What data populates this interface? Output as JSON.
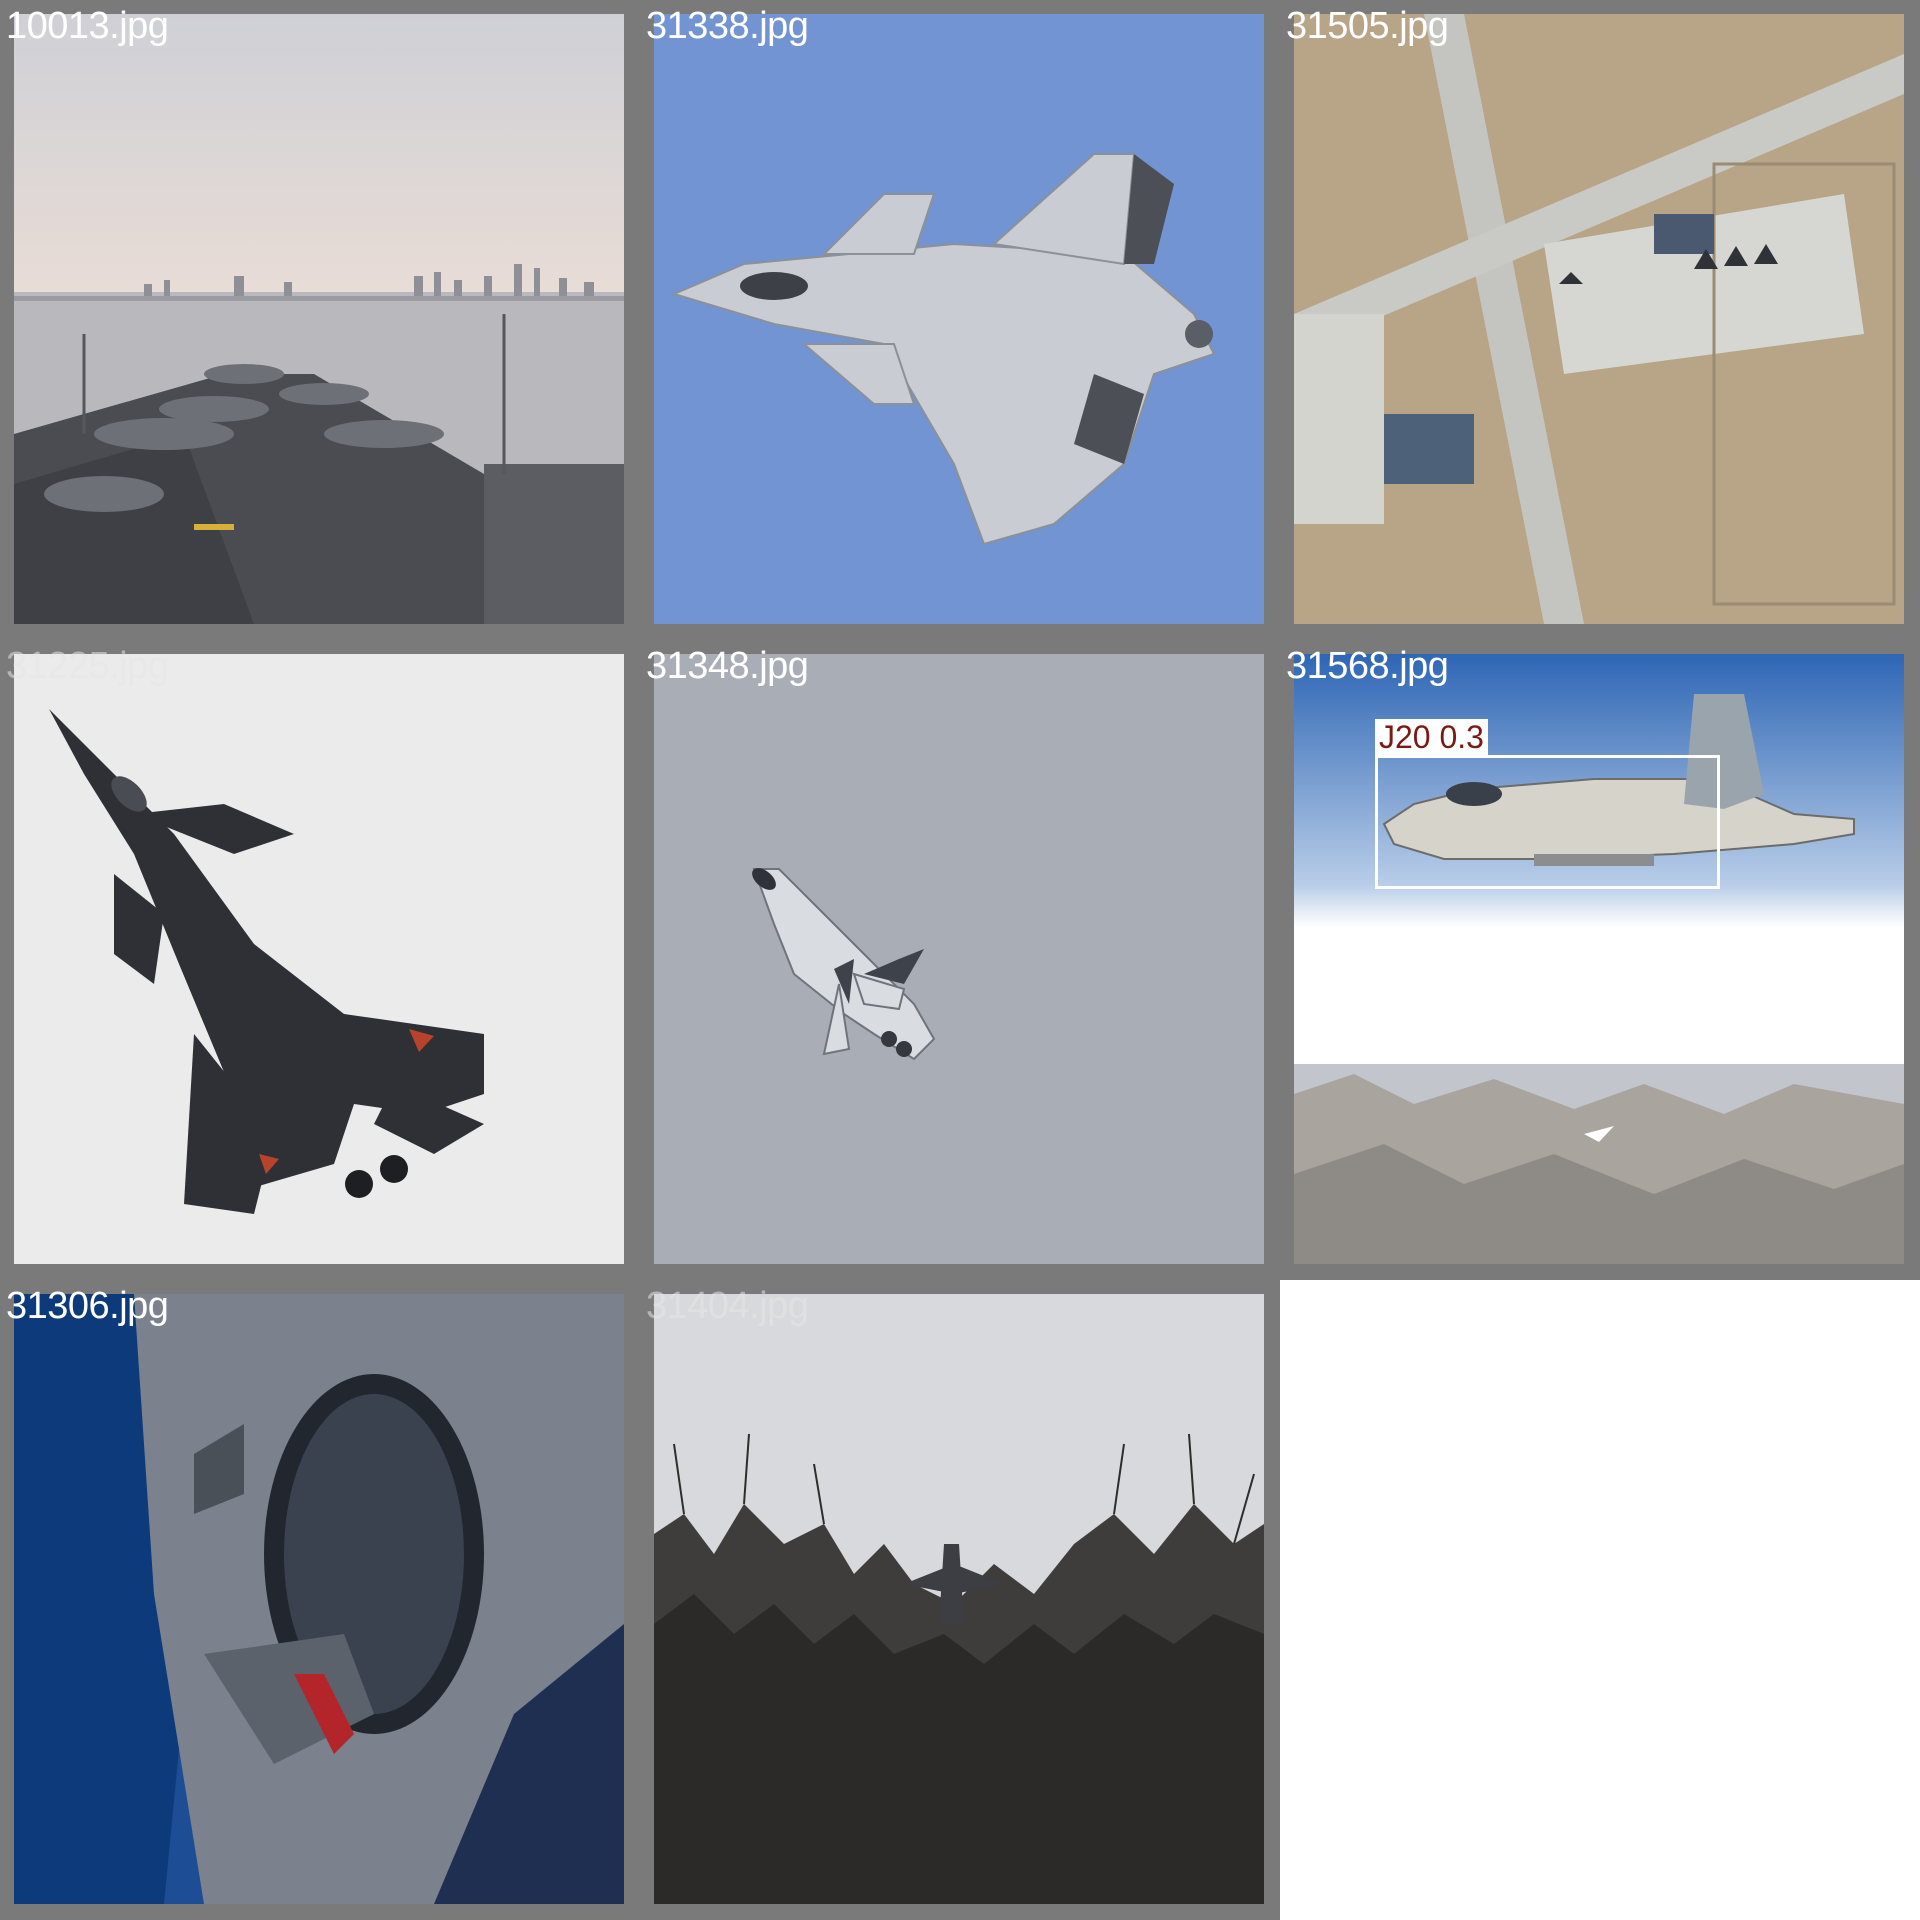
{
  "tiles": [
    {
      "filename": "10013.jpg",
      "scene": "aircraft-carrier-deck-harbor"
    },
    {
      "filename": "31338.jpg",
      "scene": "grey-stealth-fighter-blue-sky"
    },
    {
      "filename": "31505.jpg",
      "scene": "satellite-airbase"
    },
    {
      "filename": "31225.jpg",
      "scene": "dark-stealth-fighter-white-sky"
    },
    {
      "filename": "31348.jpg",
      "scene": "fighter-climbing-grey-sky"
    },
    {
      "filename": "31568.jpg",
      "scene": "fighter-over-mountains",
      "detection": {
        "label": "J20 0.3"
      }
    },
    {
      "filename": "31306.jpg",
      "scene": "cockpit-closeup-blue"
    },
    {
      "filename": "31404.jpg",
      "scene": "fighter-over-trees"
    }
  ],
  "colors": {
    "tile_border": "#7a7a7a",
    "label_text": "#ffffff",
    "detection_box": "#ffffff",
    "detection_text": "#7a1a12"
  }
}
